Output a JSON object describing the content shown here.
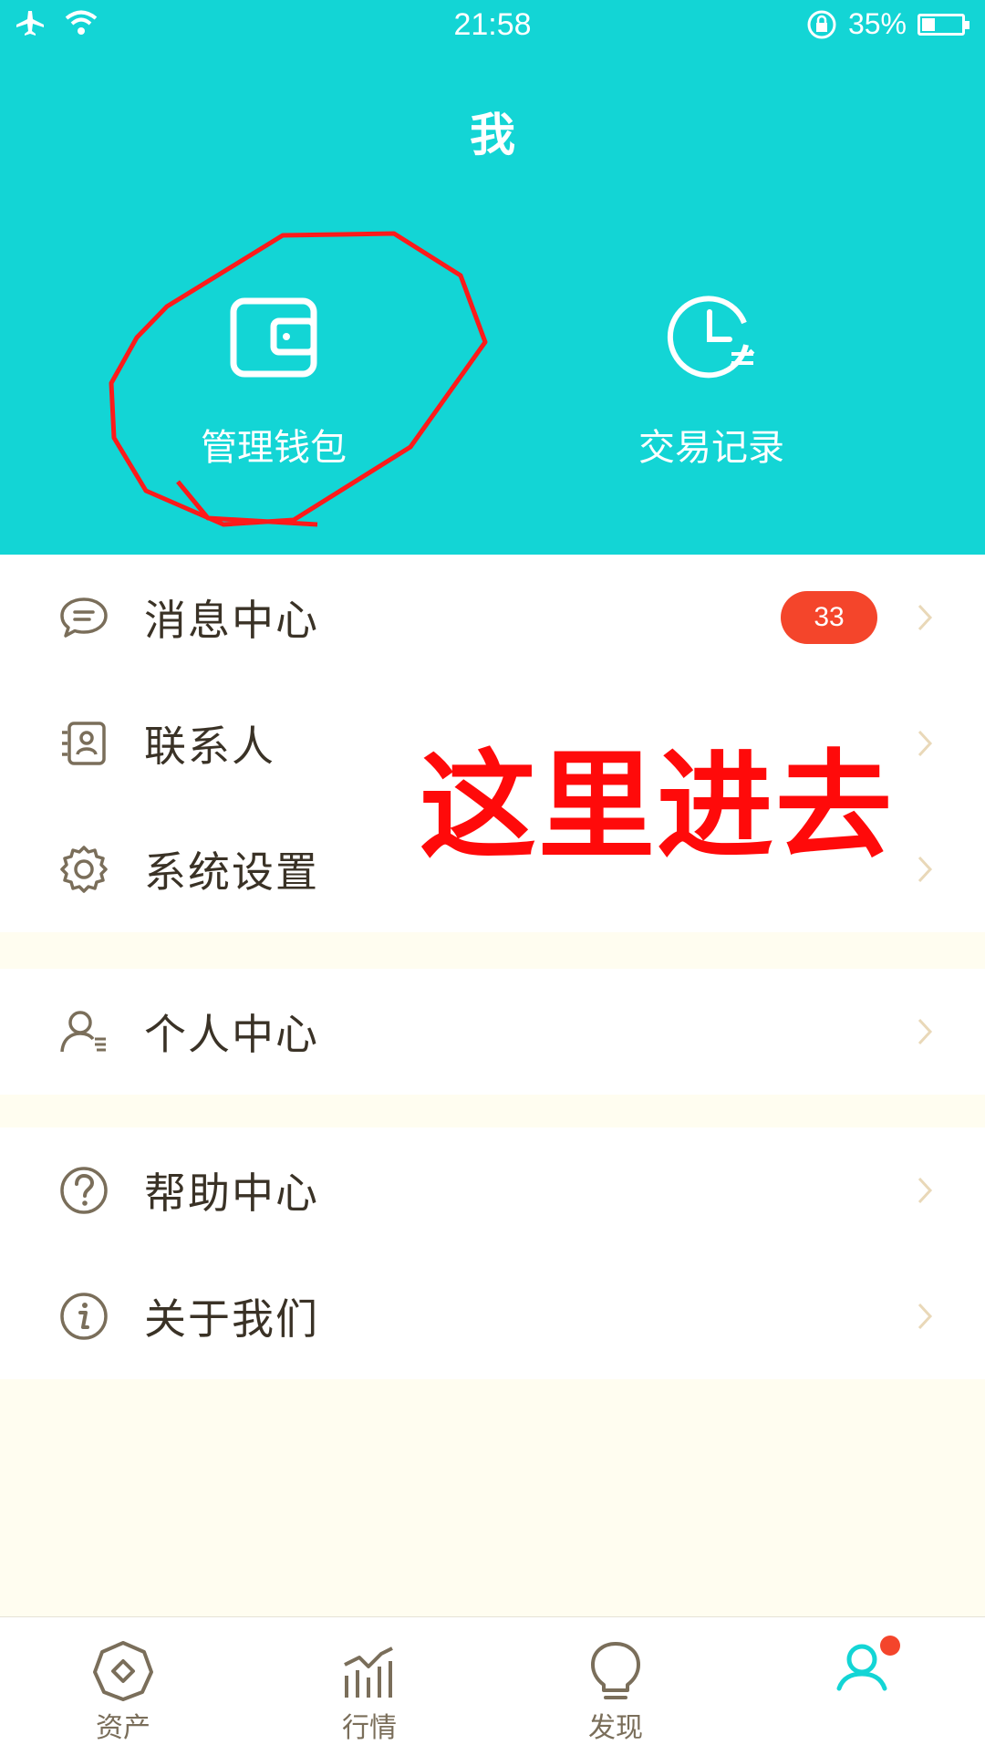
{
  "status_bar": {
    "time": "21:58",
    "battery_percent": "35%",
    "battery_level": 0.35
  },
  "header": {
    "title": "我"
  },
  "shortcuts": [
    {
      "label": "管理钱包",
      "icon": "wallet-icon"
    },
    {
      "label": "交易记录",
      "icon": "clock-icon"
    }
  ],
  "menu": {
    "group1": [
      {
        "label": "消息中心",
        "icon": "message-icon",
        "badge": "33"
      },
      {
        "label": "联系人",
        "icon": "contacts-icon"
      },
      {
        "label": "系统设置",
        "icon": "gear-icon"
      }
    ],
    "group2": [
      {
        "label": "个人中心",
        "icon": "user-icon"
      }
    ],
    "group3": [
      {
        "label": "帮助中心",
        "icon": "help-icon"
      },
      {
        "label": "关于我们",
        "icon": "info-icon"
      }
    ]
  },
  "annotation": {
    "text": "这里进去"
  },
  "tabs": [
    {
      "label": "资产",
      "icon": "asset-icon"
    },
    {
      "label": "行情",
      "icon": "market-icon"
    },
    {
      "label": "发现",
      "icon": "discover-icon"
    },
    {
      "label": "",
      "icon": "profile-icon",
      "active": true
    }
  ],
  "colors": {
    "accent": "#13d5d5",
    "badge": "#f4452b",
    "annotation": "#ff0a0a",
    "background": "#fffdf0"
  }
}
